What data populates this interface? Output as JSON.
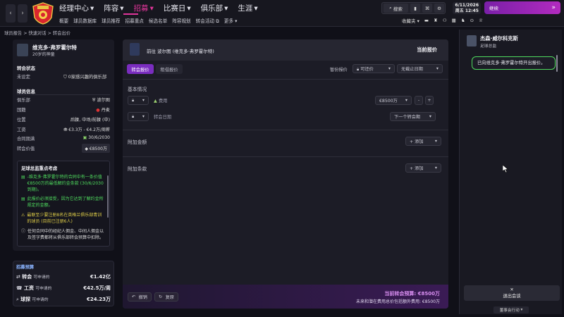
{
  "topbar": {
    "menu": [
      "经理中心",
      "阵容",
      "招募",
      "比赛日",
      "俱乐部",
      "生涯"
    ],
    "active_menu": "招募",
    "submenu": [
      "概要",
      "球员数据库",
      "球员推荐",
      "招募重点",
      "候选名单",
      "阵容规划",
      "转会活动",
      "更多"
    ],
    "search": "搜索",
    "date": "6/11/2026",
    "day_time": "周五 12:45",
    "continue": "继续",
    "inbox": "收藏夹"
  },
  "breadcrumb": "球员报告 > 快速对话 > 转会出价",
  "player": {
    "name": "维克多·弗罗霍尔特",
    "age": "20岁的神童",
    "status_title": "转会状态",
    "status": "未设定",
    "interested": "0家感兴趣的俱乐部",
    "info_title": "球员信息",
    "rows": [
      {
        "label": "俱乐部",
        "value": "波尔图"
      },
      {
        "label": "国籍",
        "value": "丹麦"
      },
      {
        "label": "位置",
        "value": "后腰, 中场/前腰 (中)"
      },
      {
        "label": "工资",
        "value": "€3.3万 - €4.2万/周薪"
      },
      {
        "label": "合同期满",
        "value": "30/6/2030"
      },
      {
        "label": "转会价值",
        "value": "€8500万"
      }
    ]
  },
  "scout": {
    "title": "足球总监重点考虑",
    "items": [
      {
        "text": "-维克多·弗罗霍尔特的合同中有一条价值€8500万的最低解约金条款 (30/6/2030到期)。",
        "color": "green"
      },
      {
        "text": "此报价必须接受，因为它达到了解约金所规定的金额。",
        "color": "green"
      },
      {
        "text": "最联至少要注册8名在英格兰俱乐部青训的球员 (目前已注册6人)",
        "color": "yellow"
      },
      {
        "text": "任何合同中的经纪人佣金、中间人佣金以及签字费都将从俱乐部转会预算中扣除。",
        "color": "white"
      }
    ]
  },
  "budget": {
    "title": "招募预算",
    "rows": [
      {
        "label": "转会",
        "sub": "可申请的",
        "value": "€1.42亿"
      },
      {
        "label": "工资",
        "sub": "可申请的",
        "value": "€42.5万/周"
      },
      {
        "label": "球探",
        "sub": "可申请的",
        "value": "€24.23万"
      }
    ]
  },
  "offer": {
    "header": "前往 波尔图 (维克多·弗罗霍尔特)",
    "current_offer": "当前报价",
    "tabs": [
      "转会报价",
      "租借报价"
    ],
    "active_tab": "转会报价",
    "counter_label": "暂份报价",
    "counter_value": "可还价",
    "deadline_value": "无截止日期",
    "basic_title": "基本情况",
    "fee_label": "费用",
    "fee_value": "€8500万",
    "date_label": "转会日期",
    "date_value": "下一个转会期",
    "add_title": "附加金额",
    "clause_title": "附加条款",
    "add_label": "添加",
    "undo": "撤销",
    "reset": "复原",
    "budget_line": "当前转会预算: €8500万",
    "budget_sub": "未来和潜在费用总价包括额外费用: €8500万"
  },
  "chat": {
    "contact_name": "杰森·威尔科克斯",
    "contact_role": "足球总监",
    "message": "已向维克多·弗罗霍尔特开出报价。",
    "exit": "退出会谈",
    "board": "董事会行动"
  },
  "colors": {
    "accent": "#e0359a",
    "purple": "#7a2dbf",
    "green": "#4fdc5e",
    "yellow": "#e2d048"
  }
}
